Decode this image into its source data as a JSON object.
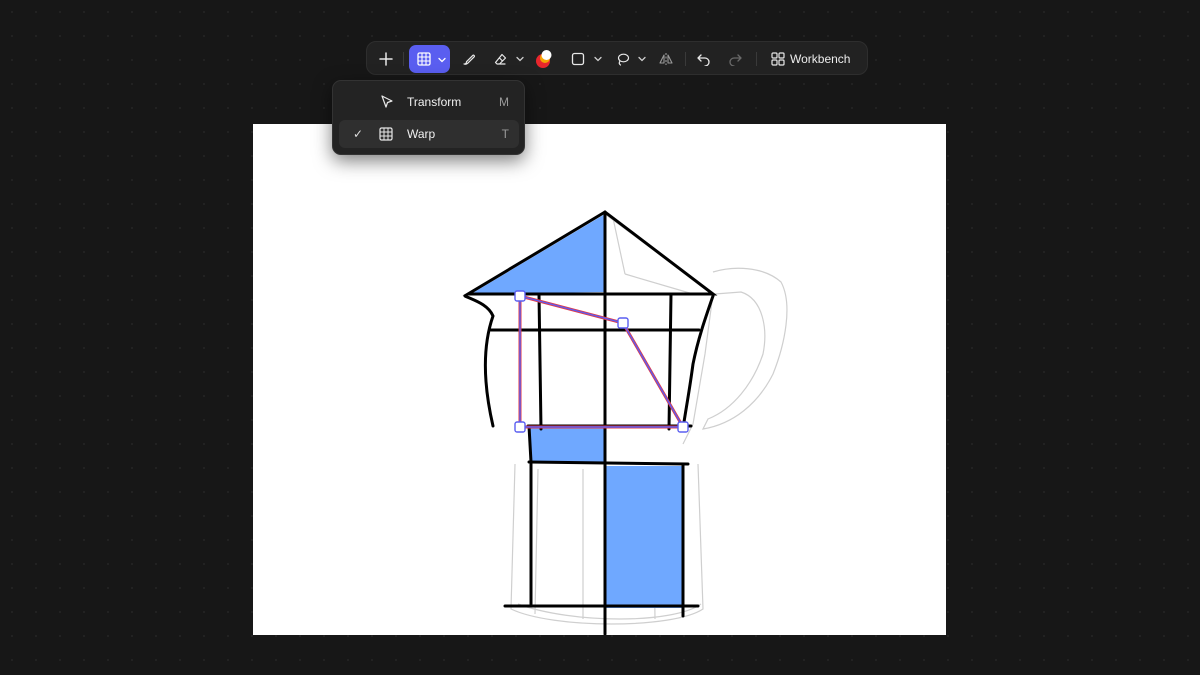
{
  "toolbar": {
    "add_icon": "plus-icon",
    "warp_icon": "grid-icon",
    "brush_icon": "brush-icon",
    "eraser_icon": "eraser-icon",
    "color_icon": "color-swatch-icon",
    "shape_icon": "square-icon",
    "lasso_icon": "lasso-icon",
    "flip_icon": "flip-icon",
    "undo_icon": "undo-icon",
    "redo_icon": "redo-icon",
    "workbench_label": "Workbench",
    "accent_color": "#5a5ef0"
  },
  "transform_menu": {
    "items": [
      {
        "label": "Transform",
        "shortcut": "M",
        "icon": "cursor-arrow-icon",
        "selected": false
      },
      {
        "label": "Warp",
        "shortcut": "T",
        "icon": "grid-icon",
        "selected": true
      }
    ],
    "check_mark": "✓"
  },
  "canvas": {
    "background": "#ffffff",
    "fill_color": "#6fa8ff",
    "grid_line_color": "#000000",
    "warp_outline_color": "#e03a4a",
    "warp_handle_color": "#5a5ef0"
  }
}
